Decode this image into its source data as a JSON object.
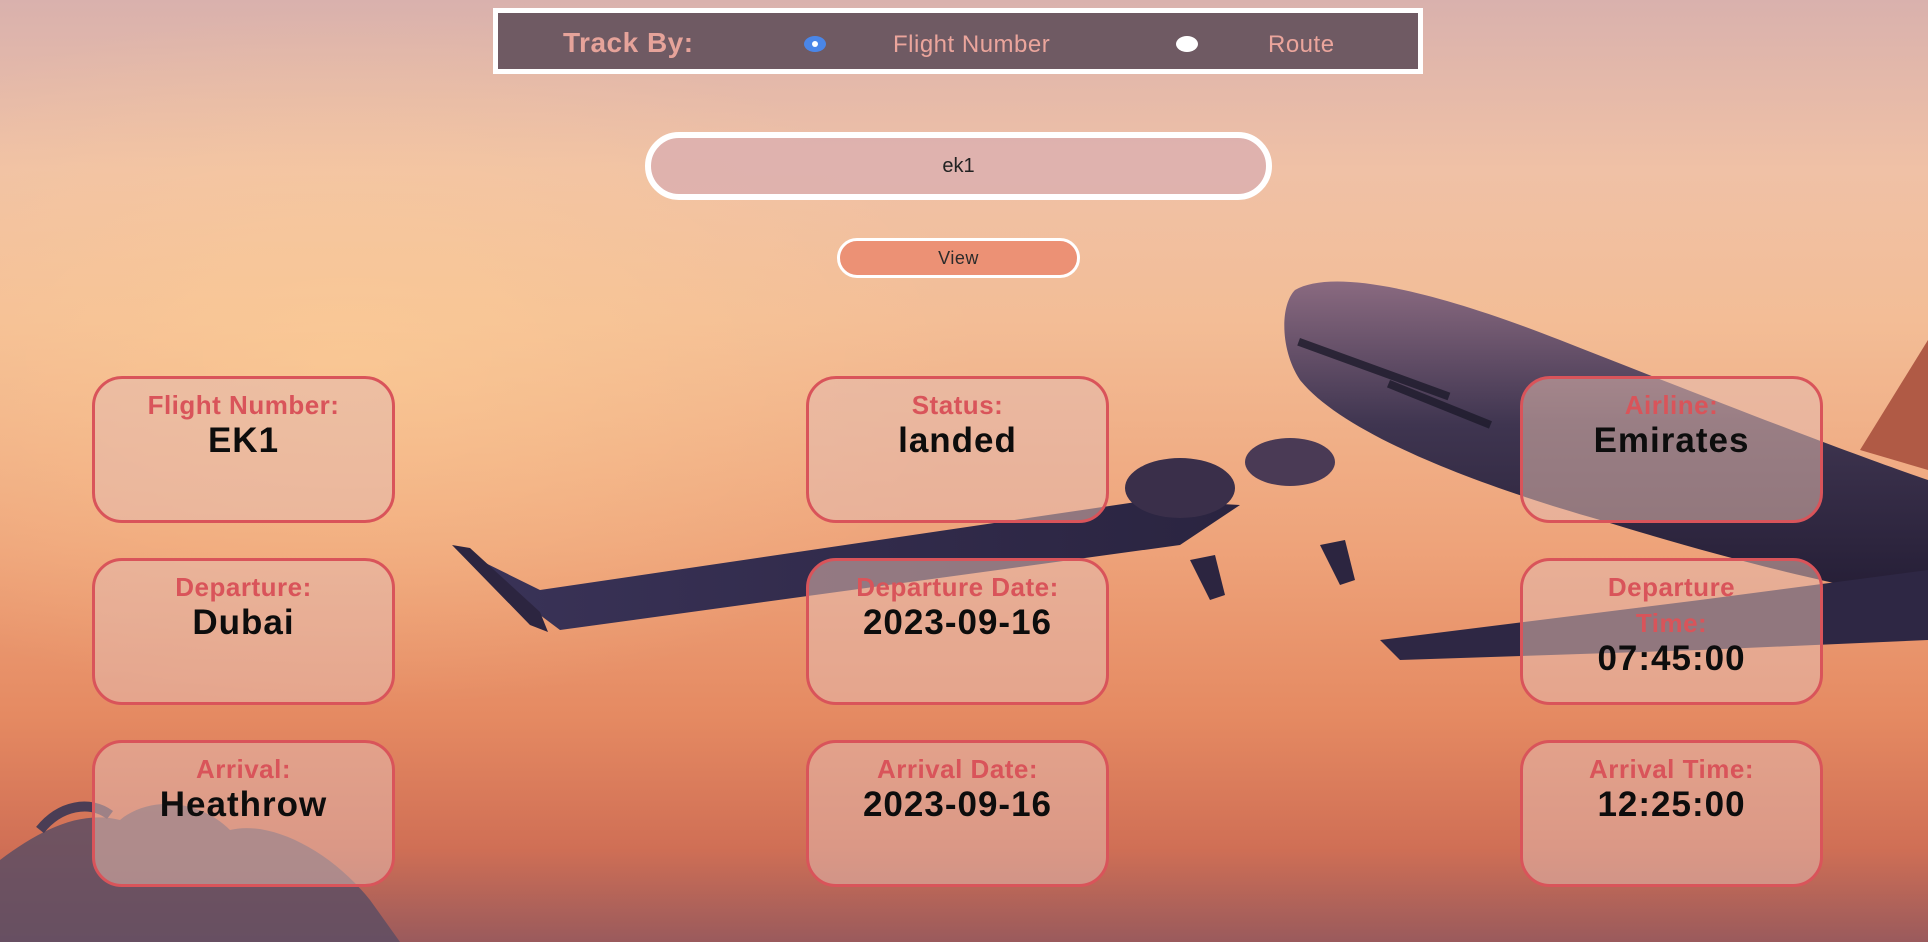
{
  "track_by": {
    "label": "Track By:",
    "options": [
      {
        "label": "Flight Number",
        "selected": true
      },
      {
        "label": "Route",
        "selected": false
      }
    ]
  },
  "search": {
    "value": "ek1"
  },
  "view_button": {
    "label": "View"
  },
  "flight_info": [
    {
      "label": "Flight Number:",
      "value": "EK1"
    },
    {
      "label": "Status:",
      "value": "landed"
    },
    {
      "label": "Airline:",
      "value": "Emirates"
    },
    {
      "label": "Departure:",
      "value": "Dubai"
    },
    {
      "label": "Departure Date:",
      "value": "2023-09-16"
    },
    {
      "label": "Departure Time:",
      "value": "07:45:00"
    },
    {
      "label": "Arrival:",
      "value": "Heathrow"
    },
    {
      "label": "Arrival Date:",
      "value": "2023-09-16"
    },
    {
      "label": "Arrival Time:",
      "value": "12:25:00"
    }
  ],
  "colors": {
    "track_bar_bg": "#6f5a63",
    "accent_red": "#d9545a",
    "view_button_bg": "#ec9175",
    "radio_selected": "#4a86e8"
  },
  "icons": [
    "airplane-background-image"
  ]
}
